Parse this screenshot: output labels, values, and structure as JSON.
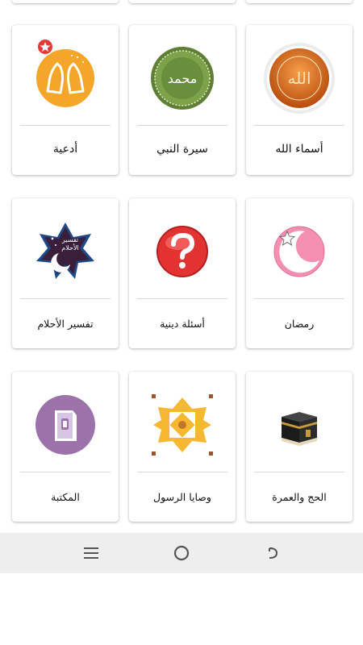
{
  "grid": {
    "row1": [
      {
        "id": "duaa",
        "label": "أدعية"
      },
      {
        "id": "seerah",
        "label": "سيرة النبي"
      },
      {
        "id": "asmaa",
        "label": "أسماء الله"
      }
    ],
    "row2": [
      {
        "id": "dreams",
        "label": "تفسير الأحلام"
      },
      {
        "id": "questions",
        "label": "أسئلة دينية"
      },
      {
        "id": "ramadan",
        "label": "رمضان"
      }
    ],
    "row3": [
      {
        "id": "library",
        "label": "المكتبة"
      },
      {
        "id": "wasaya",
        "label": "وصايا الرسول"
      },
      {
        "id": "hajj",
        "label": "الحج والعمرة"
      }
    ]
  },
  "icons": {
    "duaa": "hands-praying-icon",
    "seerah": "prophet-calligraphy-icon",
    "asmaa": "allah-calligraphy-icon",
    "dreams": "dream-interpretation-icon",
    "questions": "question-mark-icon",
    "ramadan": "crescent-star-icon",
    "library": "book-icon",
    "wasaya": "ornament-star-icon",
    "hajj": "kaaba-icon"
  },
  "icon_text": {
    "seerah_calligraphy": "محمد",
    "asmaa_calligraphy": "الله",
    "dreams_line1": "تفسير",
    "dreams_line2": "الأحلام"
  },
  "colors": {
    "duaa_bg": "#f4a62a",
    "badge": "#e53935",
    "seerah_bg": "#6a8f3c",
    "asmaa_bg": "#e0701a",
    "question_bg": "#e23232",
    "ramadan_bg": "#f48fb1",
    "library_bg": "#9b72aa",
    "wasaya_bg": "#f6b830",
    "navbar_bg": "#eeeeee"
  },
  "navbar": {
    "buttons": [
      "menu-icon",
      "home-circle-icon",
      "back-icon"
    ]
  }
}
